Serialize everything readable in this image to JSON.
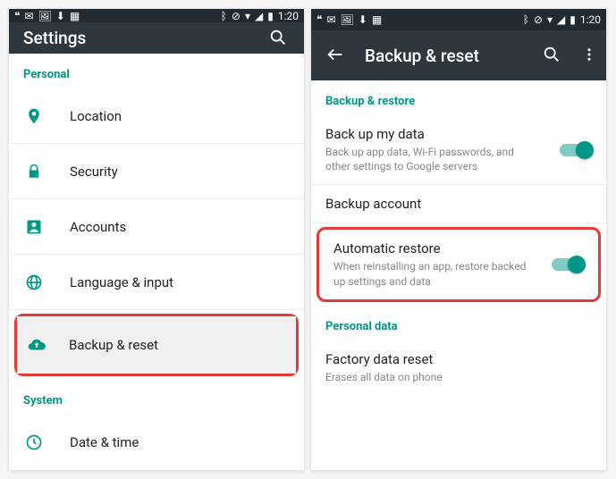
{
  "statusbar": {
    "time": "1:20",
    "icons_left": [
      "hangouts",
      "envelope",
      "image",
      "download",
      "app"
    ],
    "icons_right": [
      "bluetooth",
      "no-disturb",
      "wifi",
      "signal",
      "battery"
    ]
  },
  "colors": {
    "accent": "#009688",
    "highlight": "#e53935",
    "appbar": "#2d373d"
  },
  "left": {
    "title": "Settings",
    "section1": "Personal",
    "items": [
      {
        "icon": "location",
        "label": "Location"
      },
      {
        "icon": "lock",
        "label": "Security"
      },
      {
        "icon": "person",
        "label": "Accounts"
      },
      {
        "icon": "globe",
        "label": "Language & input"
      },
      {
        "icon": "cloud-up",
        "label": "Backup & reset",
        "highlighted": true
      }
    ],
    "section2": "System",
    "items2": [
      {
        "icon": "clock",
        "label": "Date & time"
      }
    ]
  },
  "right": {
    "title": "Backup & reset",
    "section1": "Backup & restore",
    "backup_my_data": {
      "title": "Back up my data",
      "sub": "Back up app data, Wi-Fi passwords, and other settings to Google servers",
      "on": true
    },
    "backup_account": {
      "title": "Backup account"
    },
    "auto_restore": {
      "title": "Automatic restore",
      "sub": "When reinstalling an app, restore backed up settings and data",
      "on": true,
      "highlighted": true
    },
    "section2": "Personal data",
    "factory": {
      "title": "Factory data reset",
      "sub": "Erases all data on phone"
    }
  }
}
